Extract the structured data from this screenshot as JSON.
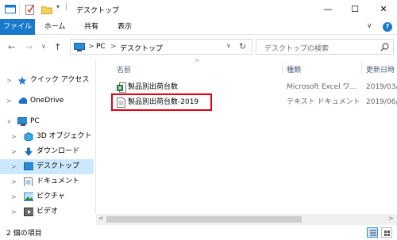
{
  "window": {
    "title": "デスクトップ",
    "minimize": "—",
    "maximize": "☐",
    "close": "✕"
  },
  "ribbon": {
    "tabs": [
      "ファイル",
      "ホーム",
      "共有",
      "表示"
    ],
    "expand": "∨",
    "help": "?"
  },
  "address": {
    "path": [
      "PC",
      "デスクトップ"
    ],
    "separator": ">",
    "search_placeholder": "デスクトップの検索"
  },
  "nav": {
    "items": [
      {
        "label": "クイック アクセス",
        "icon": "star-icon"
      },
      {
        "label": "OneDrive",
        "icon": "cloud-icon"
      },
      {
        "label": "PC",
        "icon": "pc-icon"
      },
      {
        "label": "3D オブジェクト",
        "icon": "cube-icon"
      },
      {
        "label": "ダウンロード",
        "icon": "download-icon"
      },
      {
        "label": "デスクトップ",
        "icon": "desktop-icon"
      },
      {
        "label": "ドキュメント",
        "icon": "document-icon"
      },
      {
        "label": "ピクチャ",
        "icon": "picture-icon"
      },
      {
        "label": "ビデオ",
        "icon": "video-icon"
      }
    ]
  },
  "columns": {
    "name": "名前",
    "type": "種類",
    "date": "更新日時"
  },
  "files": [
    {
      "name": "製品別出荷台数",
      "type": "Microsoft Excel ワ...",
      "date": "2019/03/2",
      "icon": "excel-icon"
    },
    {
      "name": "製品別出荷台数-2019",
      "type": "テキスト ドキュメント",
      "date": "2019/06/",
      "icon": "text-file-icon"
    }
  ],
  "status": {
    "count": "2 個の項目"
  },
  "colors": {
    "accent": "#1979ca",
    "selected": "#cce8ff",
    "highlight": "#e60012"
  }
}
